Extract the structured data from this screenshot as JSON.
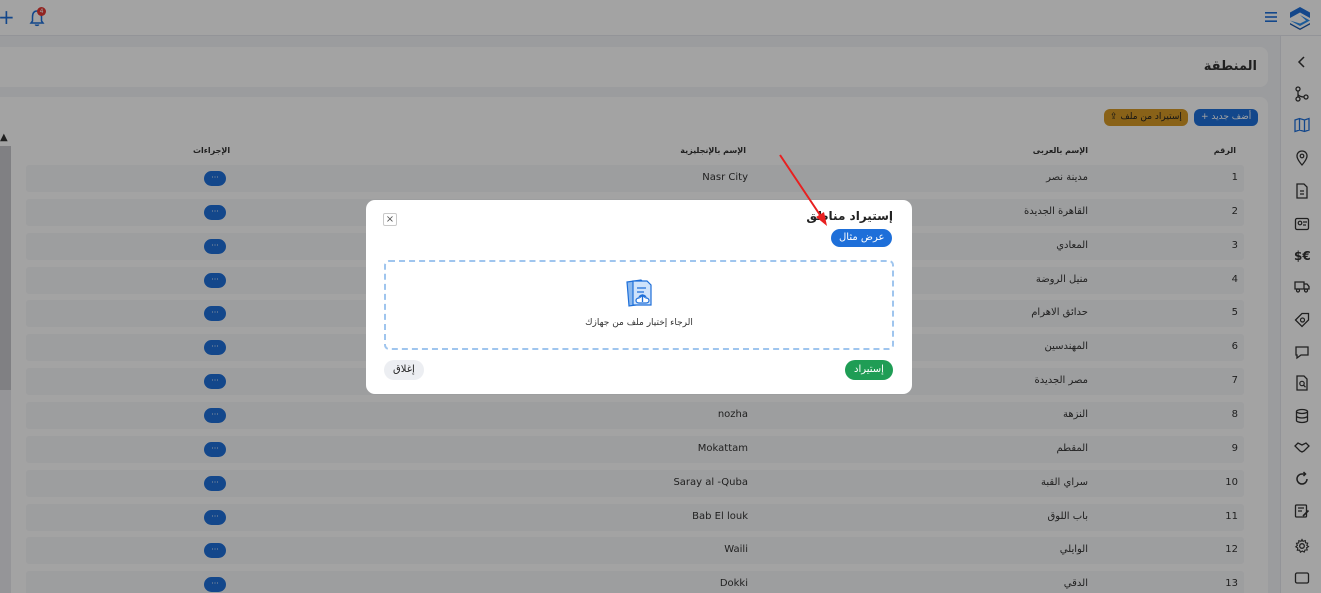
{
  "topbar": {
    "notification_count": "4"
  },
  "page": {
    "title": "المنطقة"
  },
  "toolbar": {
    "add_label": "+ أضف جديد",
    "import_file_label": "⇪ إستيراد من ملف"
  },
  "table": {
    "headers": {
      "number": "الرقم",
      "arabic_name": "الإسم بالعربى",
      "english_name": "الإسم بالإنجليزية",
      "actions": "الإجراءات"
    },
    "action_label": "···",
    "rows": [
      {
        "num": "1",
        "ar": "مدينة نصر",
        "en": "Nasr City"
      },
      {
        "num": "2",
        "ar": "القاهرة الجديدة",
        "en": ""
      },
      {
        "num": "3",
        "ar": "المعادي",
        "en": ""
      },
      {
        "num": "4",
        "ar": "منيل الروضة",
        "en": ""
      },
      {
        "num": "5",
        "ar": "حدائق الاهرام",
        "en": ""
      },
      {
        "num": "6",
        "ar": "المهندسين",
        "en": ""
      },
      {
        "num": "7",
        "ar": "مصر الجديدة",
        "en": ""
      },
      {
        "num": "8",
        "ar": "النزهة",
        "en": "nozha"
      },
      {
        "num": "9",
        "ar": "المقطم",
        "en": "Mokattam"
      },
      {
        "num": "10",
        "ar": "سراي القبة",
        "en": "Saray al -Quba"
      },
      {
        "num": "11",
        "ar": "باب اللوق",
        "en": "Bab El louk"
      },
      {
        "num": "12",
        "ar": "الوايلي",
        "en": "Waili"
      },
      {
        "num": "13",
        "ar": "الدقي",
        "en": "Dokki"
      }
    ]
  },
  "modal": {
    "title": "إستيراد مناطق",
    "close_symbol": "×",
    "example_button": "عرض مثال",
    "dropzone_hint": "الرجاء إختيار ملف من جهازك",
    "import_button": "إستيراد",
    "close_button": "إغلاق"
  },
  "icons": {
    "sidebar": [
      "chevron-left-icon",
      "branch-icon",
      "map-icon",
      "location-pin-icon",
      "file-icon",
      "id-card-icon",
      "currency-icon",
      "truck-icon",
      "tag-search-icon",
      "message-icon",
      "document-search-icon",
      "database-icon",
      "handshake-icon",
      "refresh-icon",
      "report-edit-icon",
      "settings-icon",
      "window-icon"
    ]
  },
  "colors": {
    "primary": "#1e6fd9",
    "warning": "#d79a26",
    "success": "#1f9d55",
    "annotation_arrow": "#e82020"
  }
}
